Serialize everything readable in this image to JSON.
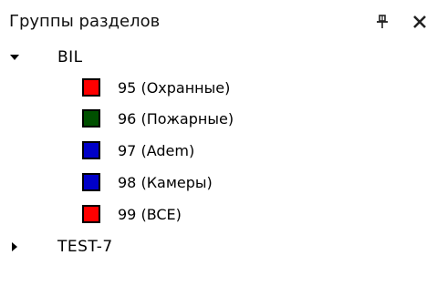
{
  "panel": {
    "title": "Группы разделов",
    "pin_icon": "pin-icon",
    "close_icon": "close-icon"
  },
  "tree": {
    "expanded_icon": "triangle-down-icon",
    "collapsed_icon": "triangle-right-icon",
    "groups": [
      {
        "label": "BIL",
        "expanded": true,
        "items": [
          {
            "label": "95 (Охранные)",
            "color": "#ff0000"
          },
          {
            "label": "96 (Пожарные)",
            "color": "#005000"
          },
          {
            "label": "97 (Adem)",
            "color": "#0000c8"
          },
          {
            "label": "98 (Камеры)",
            "color": "#0000c8"
          },
          {
            "label": "99 (BCE)",
            "color": "#ff0000"
          }
        ]
      },
      {
        "label": "TEST-7",
        "expanded": false,
        "items": []
      }
    ]
  }
}
